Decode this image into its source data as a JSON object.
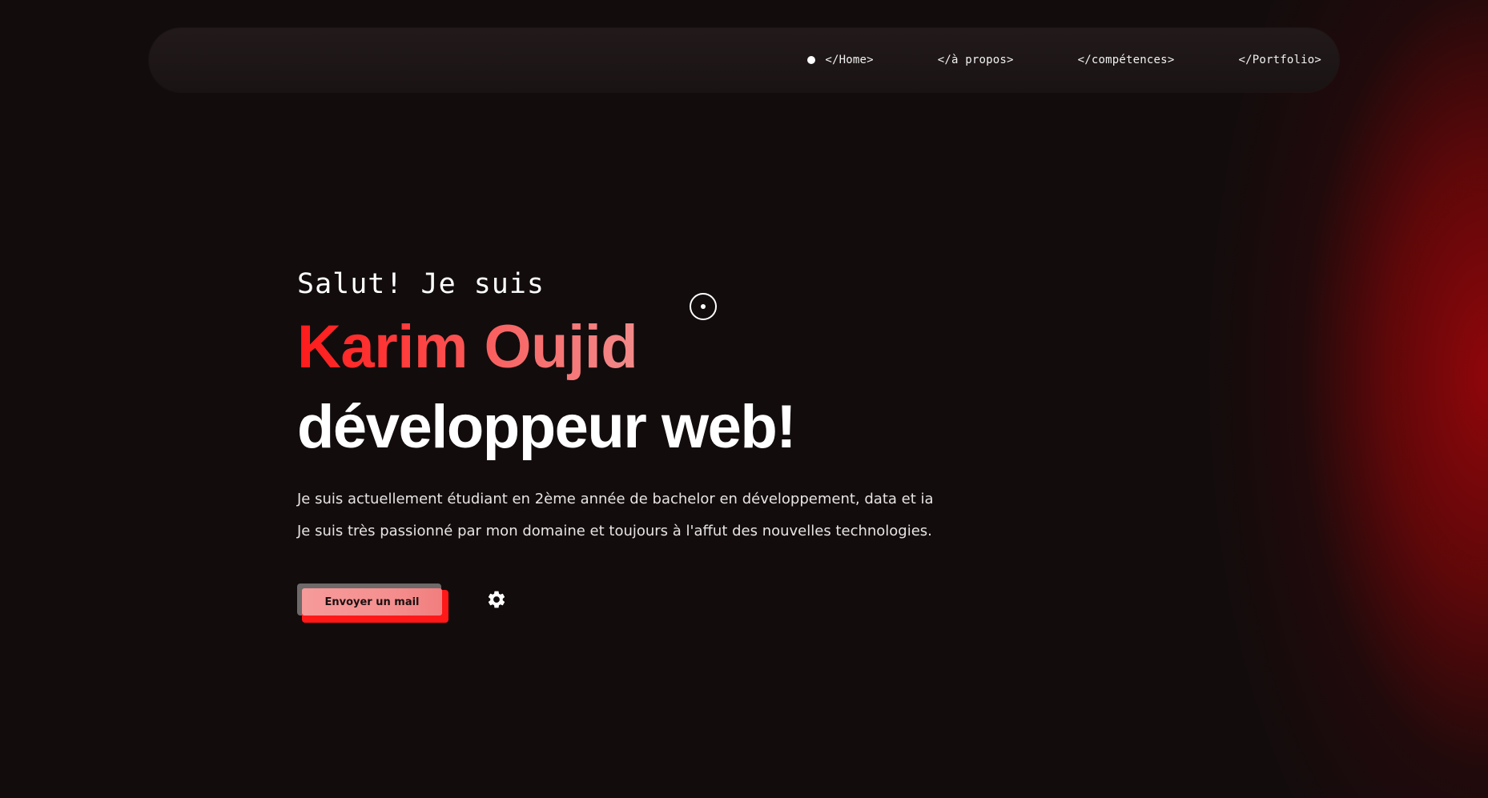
{
  "nav": {
    "items": [
      {
        "label": "</Home>",
        "active": true
      },
      {
        "label": "</à propos>",
        "active": false
      },
      {
        "label": "</compétences>",
        "active": false
      },
      {
        "label": "</Portfolio>",
        "active": false
      }
    ]
  },
  "hero": {
    "greeting": "Salut! Je suis",
    "name": "Karim Oujid",
    "role": "développeur web!",
    "description": [
      "Je suis actuellement étudiant en 2ème année de bachelor en développement, data et ia",
      "Je suis très passionné par mon domaine et toujours à l'affut des nouvelles technologies."
    ]
  },
  "actions": {
    "mail_button_label": "Envoyer un mail",
    "settings_icon": "gear-icon"
  },
  "colors": {
    "background": "#120c0d",
    "accent_red": "#ff1a1a",
    "accent_pink": "#f38a8a",
    "glow": "#96060a"
  }
}
